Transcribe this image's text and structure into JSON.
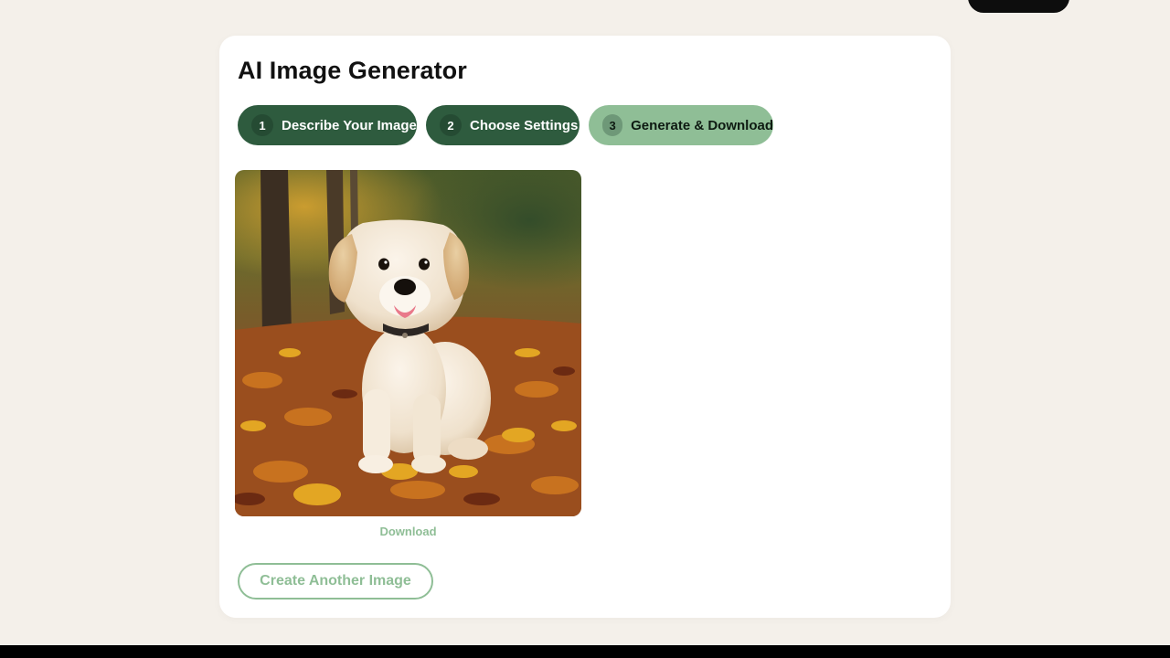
{
  "colors": {
    "page_background": "#f4f0ea",
    "card_background": "#ffffff",
    "step_done": "#2e5b3e",
    "step_active": "#8fbe96",
    "accent_text": "#8fbe96"
  },
  "generator": {
    "title": "AI Image Generator",
    "steps": [
      {
        "number": "1",
        "label": "Describe Your Image",
        "state": "completed"
      },
      {
        "number": "2",
        "label": "Choose Settings",
        "state": "completed"
      },
      {
        "number": "3",
        "label": "Generate & Download",
        "state": "active"
      }
    ],
    "result": {
      "image_subject": "golden retriever puppy sitting in autumn leaves",
      "download_label": "Download"
    },
    "create_another_label": "Create Another Image"
  }
}
